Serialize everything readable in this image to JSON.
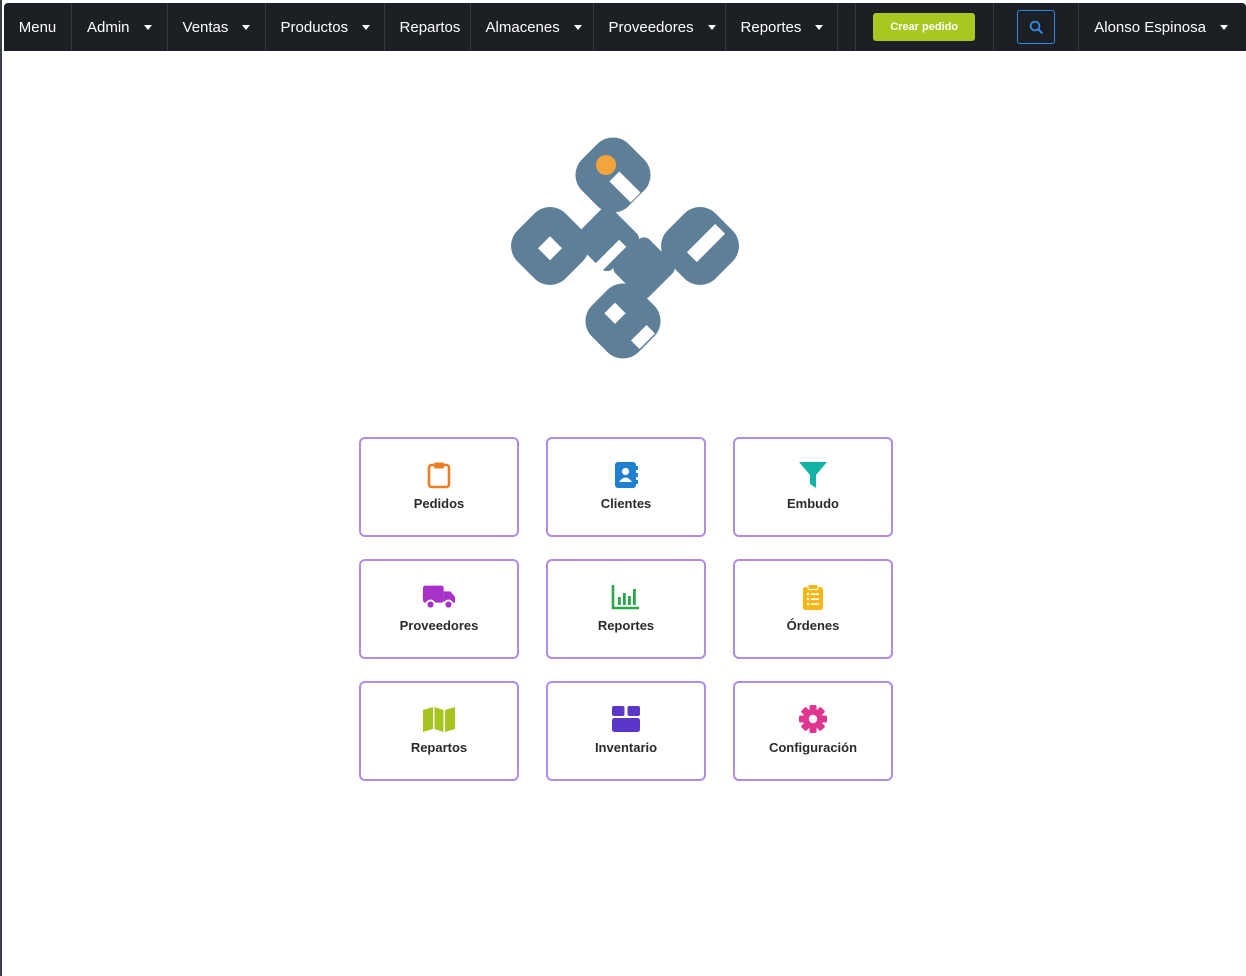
{
  "nav": {
    "menu_label": "Menu",
    "items": [
      {
        "label": "Admin",
        "has_dropdown": true
      },
      {
        "label": "Ventas",
        "has_dropdown": true
      },
      {
        "label": "Productos",
        "has_dropdown": true
      },
      {
        "label": "Repartos",
        "has_dropdown": false
      },
      {
        "label": "Almacenes",
        "has_dropdown": true
      },
      {
        "label": "Proveedores",
        "has_dropdown": true
      },
      {
        "label": "Reportes",
        "has_dropdown": true
      }
    ],
    "cta_label": "Crear pedido",
    "search_icon": "search-icon",
    "user_name": "Alonso Espinosa"
  },
  "colors": {
    "navbar_bg": "#1c1f24",
    "cta": "#a7c721",
    "search_border": "#2e8ae6",
    "tile_border": "#b18be8",
    "logo_blue": "#5e7f98",
    "logo_dot": "#f3a43b"
  },
  "tiles": [
    {
      "label": "Pedidos",
      "icon": "clipboard-icon",
      "color": "#ef7e23"
    },
    {
      "label": "Clientes",
      "icon": "address-book-icon",
      "color": "#1f7fd1"
    },
    {
      "label": "Embudo",
      "icon": "funnel-icon",
      "color": "#14b3a6"
    },
    {
      "label": "Proveedores",
      "icon": "truck-icon",
      "color": "#a831c9"
    },
    {
      "label": "Reportes",
      "icon": "bar-chart-icon",
      "color": "#29a84a"
    },
    {
      "label": "Órdenes",
      "icon": "clipboard-list-icon",
      "color": "#f6b615"
    },
    {
      "label": "Repartos",
      "icon": "map-icon",
      "color": "#a5c41f"
    },
    {
      "label": "Inventario",
      "icon": "box-icon",
      "color": "#5b37c9"
    },
    {
      "label": "Configuración",
      "icon": "gear-icon",
      "color": "#e0368f"
    }
  ]
}
